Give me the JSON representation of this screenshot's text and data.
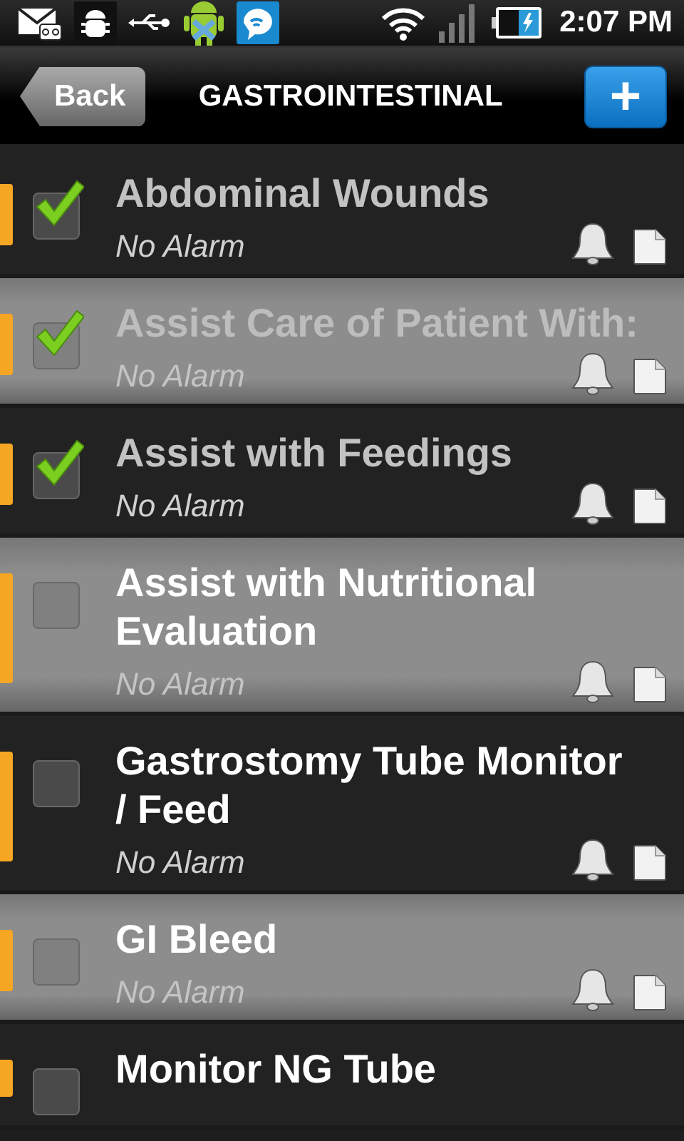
{
  "status_bar": {
    "time": "2:07 PM"
  },
  "title_bar": {
    "back": "Back",
    "title": "GASTROINTESTINAL",
    "add": "+"
  },
  "items": [
    {
      "title": "Abdominal Wounds",
      "alarm": "No Alarm",
      "checked": true
    },
    {
      "title": "Assist Care of Patient With:",
      "alarm": "No Alarm",
      "checked": true
    },
    {
      "title": "Assist with Feedings",
      "alarm": "No Alarm",
      "checked": true
    },
    {
      "title": "Assist with Nutritional Evaluation",
      "alarm": "No Alarm",
      "checked": false
    },
    {
      "title": "Gastrostomy Tube Monitor / Feed",
      "alarm": "No Alarm",
      "checked": false
    },
    {
      "title": "GI Bleed",
      "alarm": "No Alarm",
      "checked": false
    },
    {
      "title": "Monitor NG Tube",
      "checked": false
    }
  ]
}
